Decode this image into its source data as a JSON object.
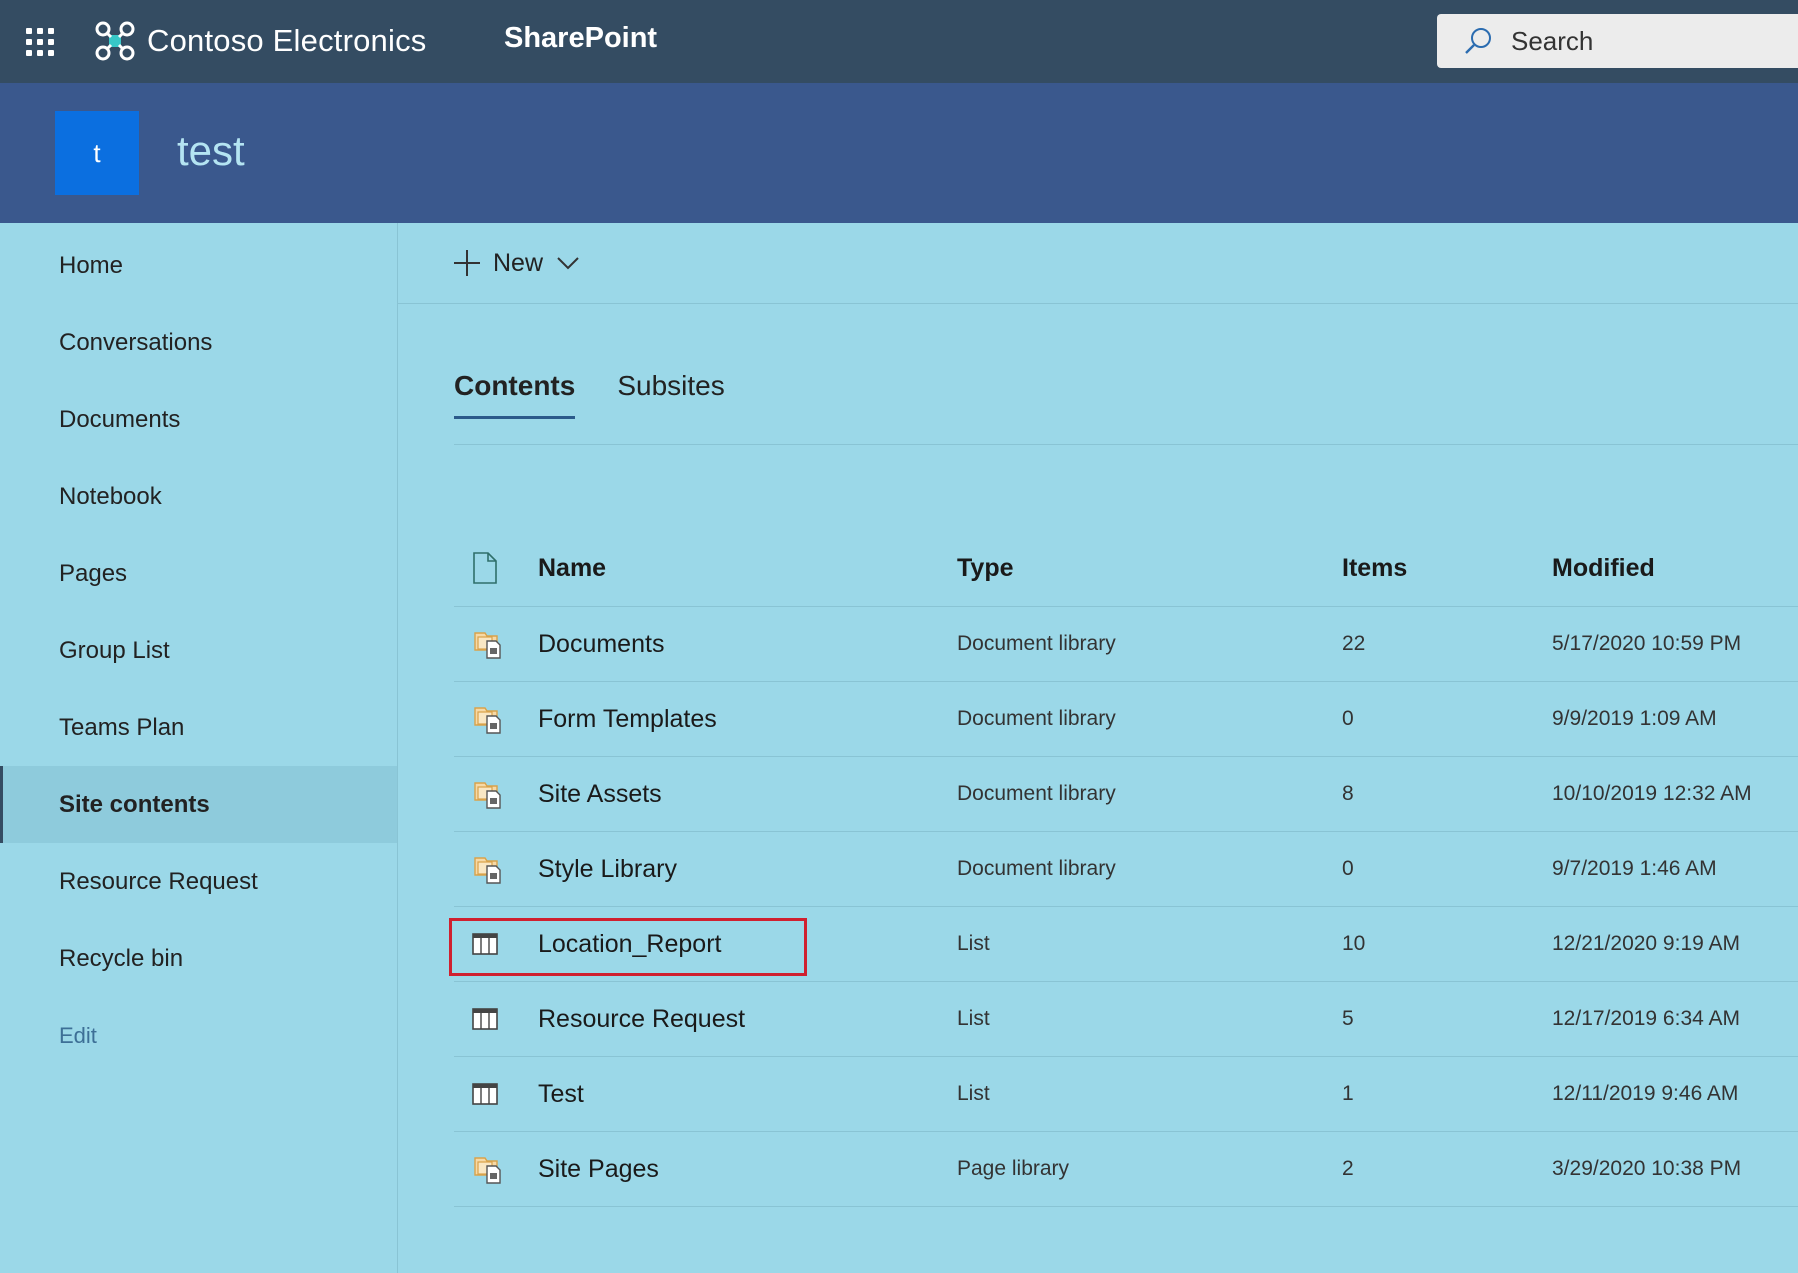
{
  "suitebar": {
    "brand_name": "Contoso Electronics",
    "app_name": "SharePoint",
    "search_placeholder": "Search"
  },
  "site": {
    "logo_letter": "t",
    "title": "test"
  },
  "nav": {
    "items": [
      {
        "label": "Home"
      },
      {
        "label": "Conversations"
      },
      {
        "label": "Documents"
      },
      {
        "label": "Notebook"
      },
      {
        "label": "Pages"
      },
      {
        "label": "Group List"
      },
      {
        "label": "Teams Plan"
      },
      {
        "label": "Site contents",
        "selected": true
      },
      {
        "label": "Resource Request"
      },
      {
        "label": "Recycle bin"
      }
    ],
    "edit_label": "Edit"
  },
  "command": {
    "new_label": "New"
  },
  "tabs": [
    {
      "label": "Contents",
      "active": true
    },
    {
      "label": "Subsites",
      "active": false
    }
  ],
  "table": {
    "headers": {
      "name": "Name",
      "type": "Type",
      "items": "Items",
      "modified": "Modified"
    },
    "rows": [
      {
        "icon": "document-library-icon",
        "name": "Documents",
        "type": "Document library",
        "items": "22",
        "modified": "5/17/2020 10:59 PM"
      },
      {
        "icon": "document-library-icon",
        "name": "Form Templates",
        "type": "Document library",
        "items": "0",
        "modified": "9/9/2019 1:09 AM"
      },
      {
        "icon": "document-library-icon",
        "name": "Site Assets",
        "type": "Document library",
        "items": "8",
        "modified": "10/10/2019 12:32 AM"
      },
      {
        "icon": "document-library-icon",
        "name": "Style Library",
        "type": "Document library",
        "items": "0",
        "modified": "9/7/2019 1:46 AM"
      },
      {
        "icon": "list-icon",
        "name": "Location_Report",
        "type": "List",
        "items": "10",
        "modified": "12/21/2020 9:19 AM",
        "highlighted": true
      },
      {
        "icon": "list-icon",
        "name": "Resource Request",
        "type": "List",
        "items": "5",
        "modified": "12/17/2019 6:34 AM"
      },
      {
        "icon": "list-icon",
        "name": "Test",
        "type": "List",
        "items": "1",
        "modified": "12/11/2019 9:46 AM"
      },
      {
        "icon": "document-library-icon",
        "name": "Site Pages",
        "type": "Page library",
        "items": "2",
        "modified": "3/29/2020 10:38 PM"
      }
    ]
  },
  "colors": {
    "suitebar": "#344c62",
    "siteheader": "#3a588d",
    "background": "#9bd8e8",
    "accent": "#0b6fe0",
    "highlight": "#d0202f"
  }
}
